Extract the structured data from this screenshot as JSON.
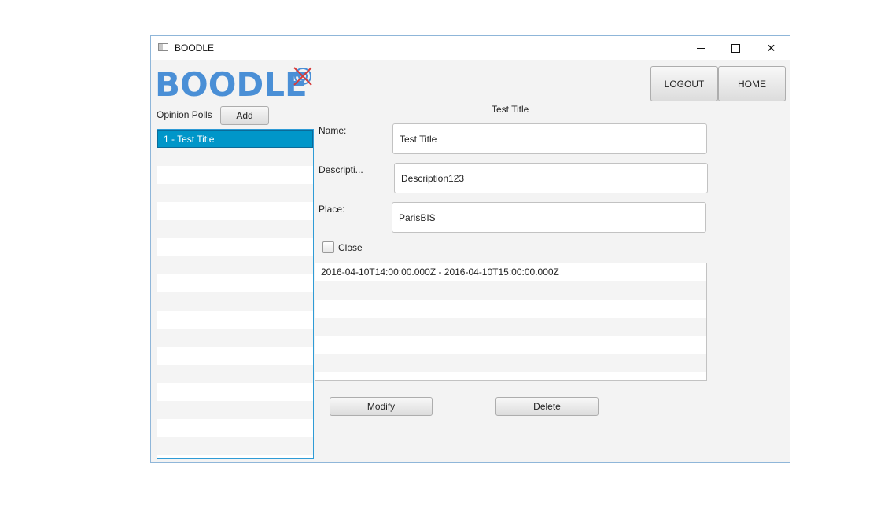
{
  "window": {
    "title": "BOODLE"
  },
  "logo": {
    "text": "BOODLE",
    "accent": "#4a8fd6"
  },
  "header": {
    "logout_label": "LOGOUT",
    "home_label": "HOME"
  },
  "sidebar": {
    "label": "Opinion Polls",
    "add_label": "Add",
    "items": [
      {
        "label": "1 - Test Title",
        "selected": true
      }
    ]
  },
  "detail": {
    "title": "Test Title",
    "name_label": "Name:",
    "name_value": "Test Title",
    "description_label": "Descripti...",
    "description_value": "Description123",
    "place_label": "Place:",
    "place_value": "ParisBIS",
    "close_label": "Close",
    "close_checked": false,
    "dates": [
      "2016-04-10T14:00:00.000Z - 2016-04-10T15:00:00.000Z"
    ],
    "modify_label": "Modify",
    "delete_label": "Delete"
  },
  "colors": {
    "selection": "#0096c9",
    "list_border": "#2e9bd6"
  },
  "icons": {
    "app": "window-icon",
    "logo_mark": "crossed-target-icon"
  }
}
